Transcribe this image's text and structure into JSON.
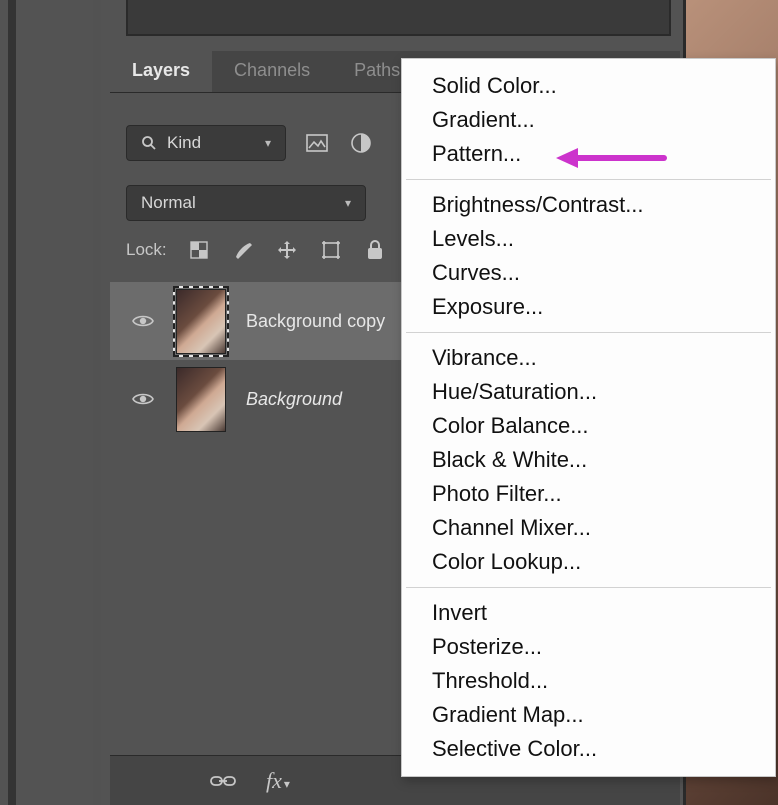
{
  "tabs": {
    "layers": "Layers",
    "channels": "Channels",
    "paths": "Paths"
  },
  "filter": {
    "kind_label": "Kind"
  },
  "blend": {
    "mode": "Normal"
  },
  "lock": {
    "label": "Lock:"
  },
  "layers": [
    {
      "name": "Background copy",
      "selected": true,
      "italic": false
    },
    {
      "name": "Background",
      "selected": false,
      "italic": true
    }
  ],
  "menu": {
    "group1": [
      "Solid Color...",
      "Gradient...",
      "Pattern..."
    ],
    "group2": [
      "Brightness/Contrast...",
      "Levels...",
      "Curves...",
      "Exposure..."
    ],
    "group3": [
      "Vibrance...",
      "Hue/Saturation...",
      "Color Balance...",
      "Black & White...",
      "Photo Filter...",
      "Channel Mixer...",
      "Color Lookup..."
    ],
    "group4": [
      "Invert",
      "Posterize...",
      "Threshold...",
      "Gradient Map...",
      "Selective Color..."
    ]
  },
  "annotation": {
    "color": "#cc33cc"
  }
}
